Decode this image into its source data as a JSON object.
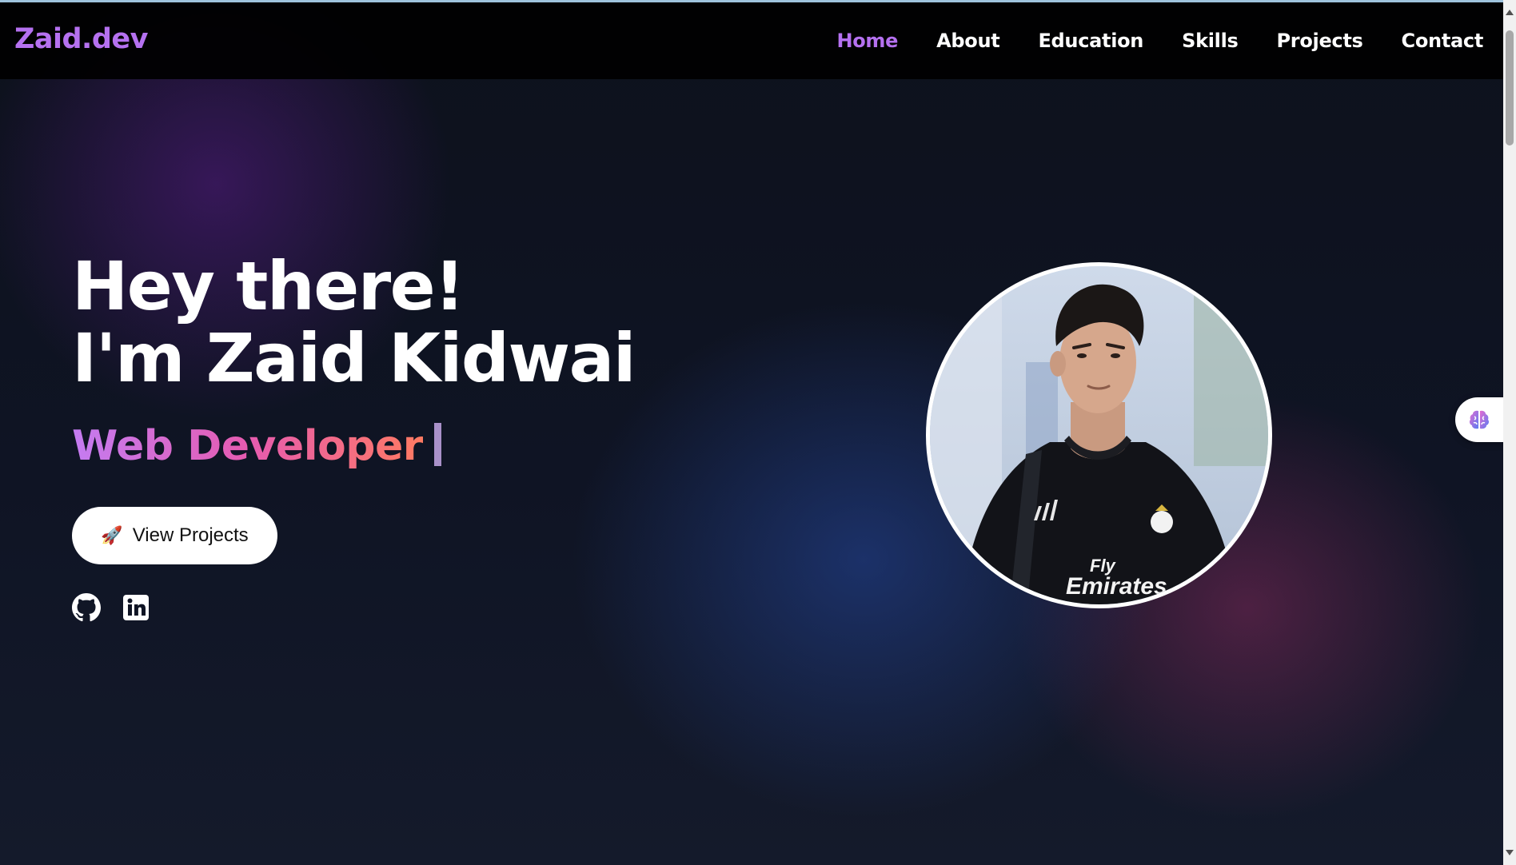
{
  "nav": {
    "logo": "Zaid.dev",
    "links": [
      {
        "label": "Home",
        "active": true
      },
      {
        "label": "About",
        "active": false
      },
      {
        "label": "Education",
        "active": false
      },
      {
        "label": "Skills",
        "active": false
      },
      {
        "label": "Projects",
        "active": false
      },
      {
        "label": "Contact",
        "active": false
      }
    ]
  },
  "hero": {
    "greeting": "Hey there!",
    "name_line": "I'm Zaid Kidwai",
    "role": "Web Developer",
    "cta": {
      "icon": "rocket-icon",
      "label": "View Projects"
    },
    "socials": [
      {
        "name": "github-icon"
      },
      {
        "name": "linkedin-icon"
      }
    ],
    "avatar": "profile-photo"
  },
  "widget": {
    "icon": "brain-icon"
  },
  "colors": {
    "accent": "#b571f0",
    "background": "#0f1424",
    "gradient_start": "#c47cf2",
    "gradient_mid": "#e65bb0",
    "gradient_end": "#ff7a62"
  }
}
